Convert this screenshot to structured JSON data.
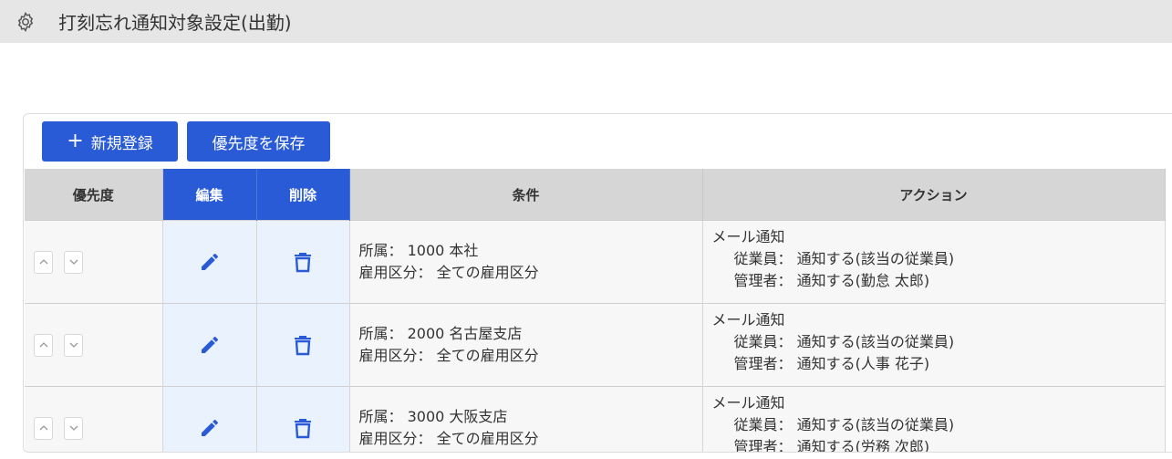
{
  "header": {
    "title": "打刻忘れ通知対象設定(出勤)",
    "icon": "gear-icon"
  },
  "toolbar": {
    "new_label": "新規登録",
    "save_priority_label": "優先度を保存"
  },
  "table": {
    "columns": [
      "優先度",
      "編集",
      "削除",
      "条件",
      "アクション"
    ],
    "rows": [
      {
        "condition_line1": "所属： 1000 本社",
        "condition_line2": "雇用区分： 全ての雇用区分",
        "action_title": "メール通知",
        "action_employee": "従業員： 通知する(該当の従業員)",
        "action_manager": "管理者： 通知する(勤怠 太郎)"
      },
      {
        "condition_line1": "所属： 2000 名古屋支店",
        "condition_line2": "雇用区分： 全ての雇用区分",
        "action_title": "メール通知",
        "action_employee": "従業員： 通知する(該当の従業員)",
        "action_manager": "管理者： 通知する(人事 花子)"
      },
      {
        "condition_line1": "所属： 3000 大阪支店",
        "condition_line2": "雇用区分： 全ての雇用区分",
        "action_title": "メール通知",
        "action_employee": "従業員： 通知する(該当の従業員)",
        "action_manager": "管理者： 通知する(労務 次郎)"
      }
    ]
  },
  "colors": {
    "accent": "#2a5bd7",
    "header_gray": "#d6d6d6",
    "action_cell_bg": "#eaf2fe"
  }
}
